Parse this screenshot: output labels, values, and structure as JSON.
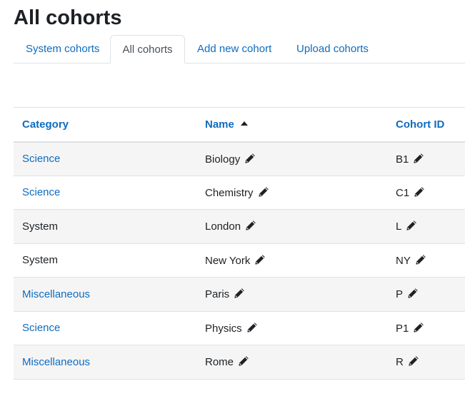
{
  "page": {
    "title": "All cohorts"
  },
  "tabs": [
    {
      "label": "System cohorts",
      "active": false
    },
    {
      "label": "All cohorts",
      "active": true
    },
    {
      "label": "Add new cohort",
      "active": false
    },
    {
      "label": "Upload cohorts",
      "active": false
    }
  ],
  "table": {
    "headers": {
      "category": "Category",
      "name": "Name",
      "cohort_id": "Cohort ID"
    },
    "sort": {
      "column": "name",
      "direction": "ascending"
    },
    "rows": [
      {
        "category": "Science",
        "category_is_link": true,
        "name": "Biology",
        "cohort_id": "B1"
      },
      {
        "category": "Science",
        "category_is_link": true,
        "name": "Chemistry",
        "cohort_id": "C1"
      },
      {
        "category": "System",
        "category_is_link": false,
        "name": "London",
        "cohort_id": "L"
      },
      {
        "category": "System",
        "category_is_link": false,
        "name": "New York",
        "cohort_id": "NY"
      },
      {
        "category": "Miscellaneous",
        "category_is_link": true,
        "name": "Paris",
        "cohort_id": "P"
      },
      {
        "category": "Science",
        "category_is_link": true,
        "name": "Physics",
        "cohort_id": "P1"
      },
      {
        "category": "Miscellaneous",
        "category_is_link": true,
        "name": "Rome",
        "cohort_id": "R"
      }
    ]
  },
  "icons": {
    "edit": "pencil-icon",
    "sort": "sort-ascending-icon"
  },
  "colors": {
    "link": "#0f6cbf",
    "text": "#1d2125",
    "border": "#dee2e6",
    "row_stripe": "#f5f5f5"
  }
}
